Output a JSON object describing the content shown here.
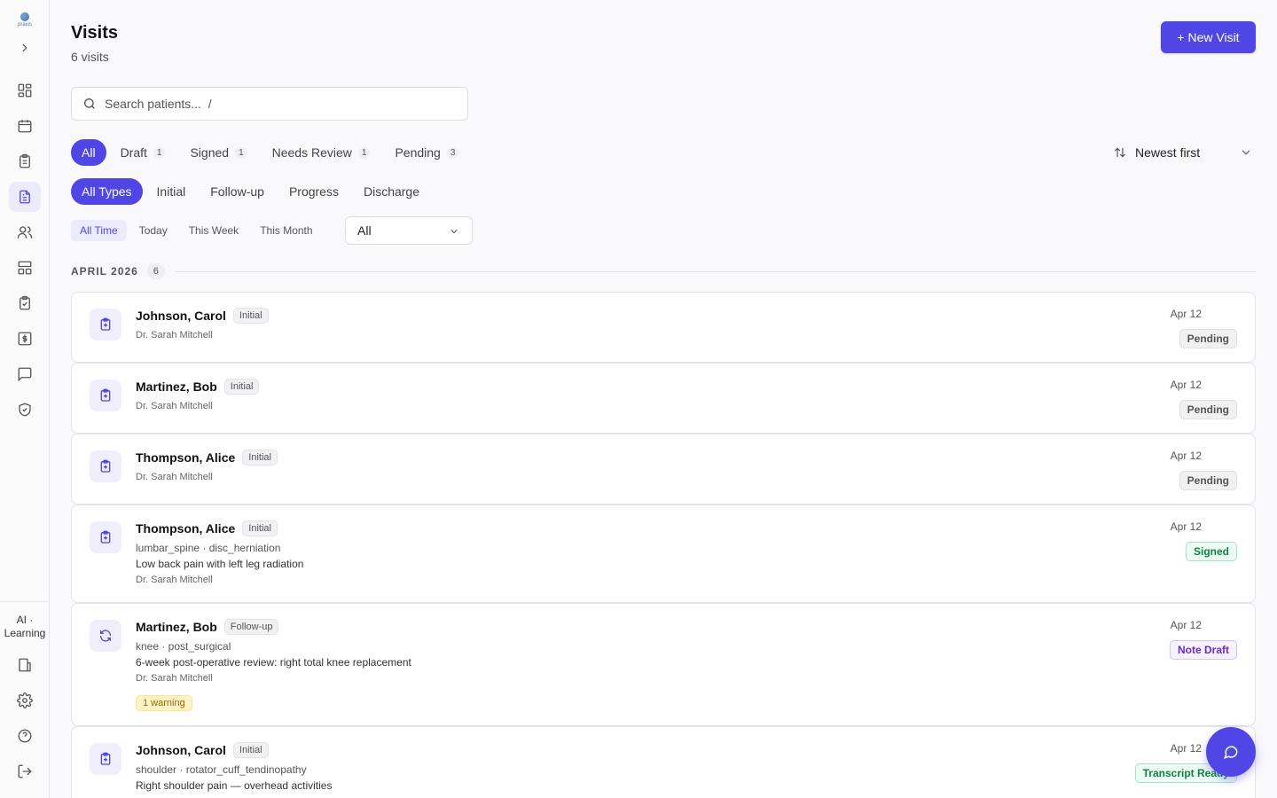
{
  "app": {
    "logo_text": "praxis"
  },
  "header": {
    "title": "Visits",
    "subtitle": "6 visits",
    "new_button": "+ New Visit"
  },
  "search": {
    "placeholder": "Search patients...  /"
  },
  "status_filters": [
    {
      "label": "All",
      "count": ""
    },
    {
      "label": "Draft",
      "count": "1"
    },
    {
      "label": "Signed",
      "count": "1"
    },
    {
      "label": "Needs Review",
      "count": "1"
    },
    {
      "label": "Pending",
      "count": "3"
    }
  ],
  "type_filters": [
    "All Types",
    "Initial",
    "Follow-up",
    "Progress",
    "Discharge"
  ],
  "time_filters": [
    "All Time",
    "Today",
    "This Week",
    "This Month"
  ],
  "provider_select": {
    "value": "All"
  },
  "sort": {
    "label": "Newest first"
  },
  "sidebar": {
    "ai_label": "AI · Learning"
  },
  "group": {
    "label": "APRIL 2026",
    "count": "6"
  },
  "visits": [
    {
      "name": "Johnson, Carol",
      "type": "Initial",
      "region": "",
      "complaint": "",
      "provider": "Dr. Sarah Mitchell",
      "date": "Apr 12",
      "status": "Pending",
      "warning": ""
    },
    {
      "name": "Martinez, Bob",
      "type": "Initial",
      "region": "",
      "complaint": "",
      "provider": "Dr. Sarah Mitchell",
      "date": "Apr 12",
      "status": "Pending",
      "warning": ""
    },
    {
      "name": "Thompson, Alice",
      "type": "Initial",
      "region": "",
      "complaint": "",
      "provider": "Dr. Sarah Mitchell",
      "date": "Apr 12",
      "status": "Pending",
      "warning": ""
    },
    {
      "name": "Thompson, Alice",
      "type": "Initial",
      "region": "lumbar_spine · disc_herniation",
      "complaint": "Low back pain with left leg radiation",
      "provider": "Dr. Sarah Mitchell",
      "date": "Apr 12",
      "status": "Signed",
      "warning": ""
    },
    {
      "name": "Martinez, Bob",
      "type": "Follow-up",
      "region": "knee · post_surgical",
      "complaint": "6-week post-operative review: right total knee replacement",
      "provider": "Dr. Sarah Mitchell",
      "date": "Apr 12",
      "status": "Note Draft",
      "warning": "1 warning"
    },
    {
      "name": "Johnson, Carol",
      "type": "Initial",
      "region": "shoulder · rotator_cuff_tendinopathy",
      "complaint": "Right shoulder pain — overhead activities",
      "provider": "",
      "date": "Apr 12",
      "status": "Transcript Ready",
      "warning": ""
    }
  ],
  "colors": {
    "accent": "#4f46e5",
    "accent_soft": "#ecebfb",
    "signed": "#15803d",
    "draft": "#6d28d9",
    "warning": "#a16207"
  }
}
